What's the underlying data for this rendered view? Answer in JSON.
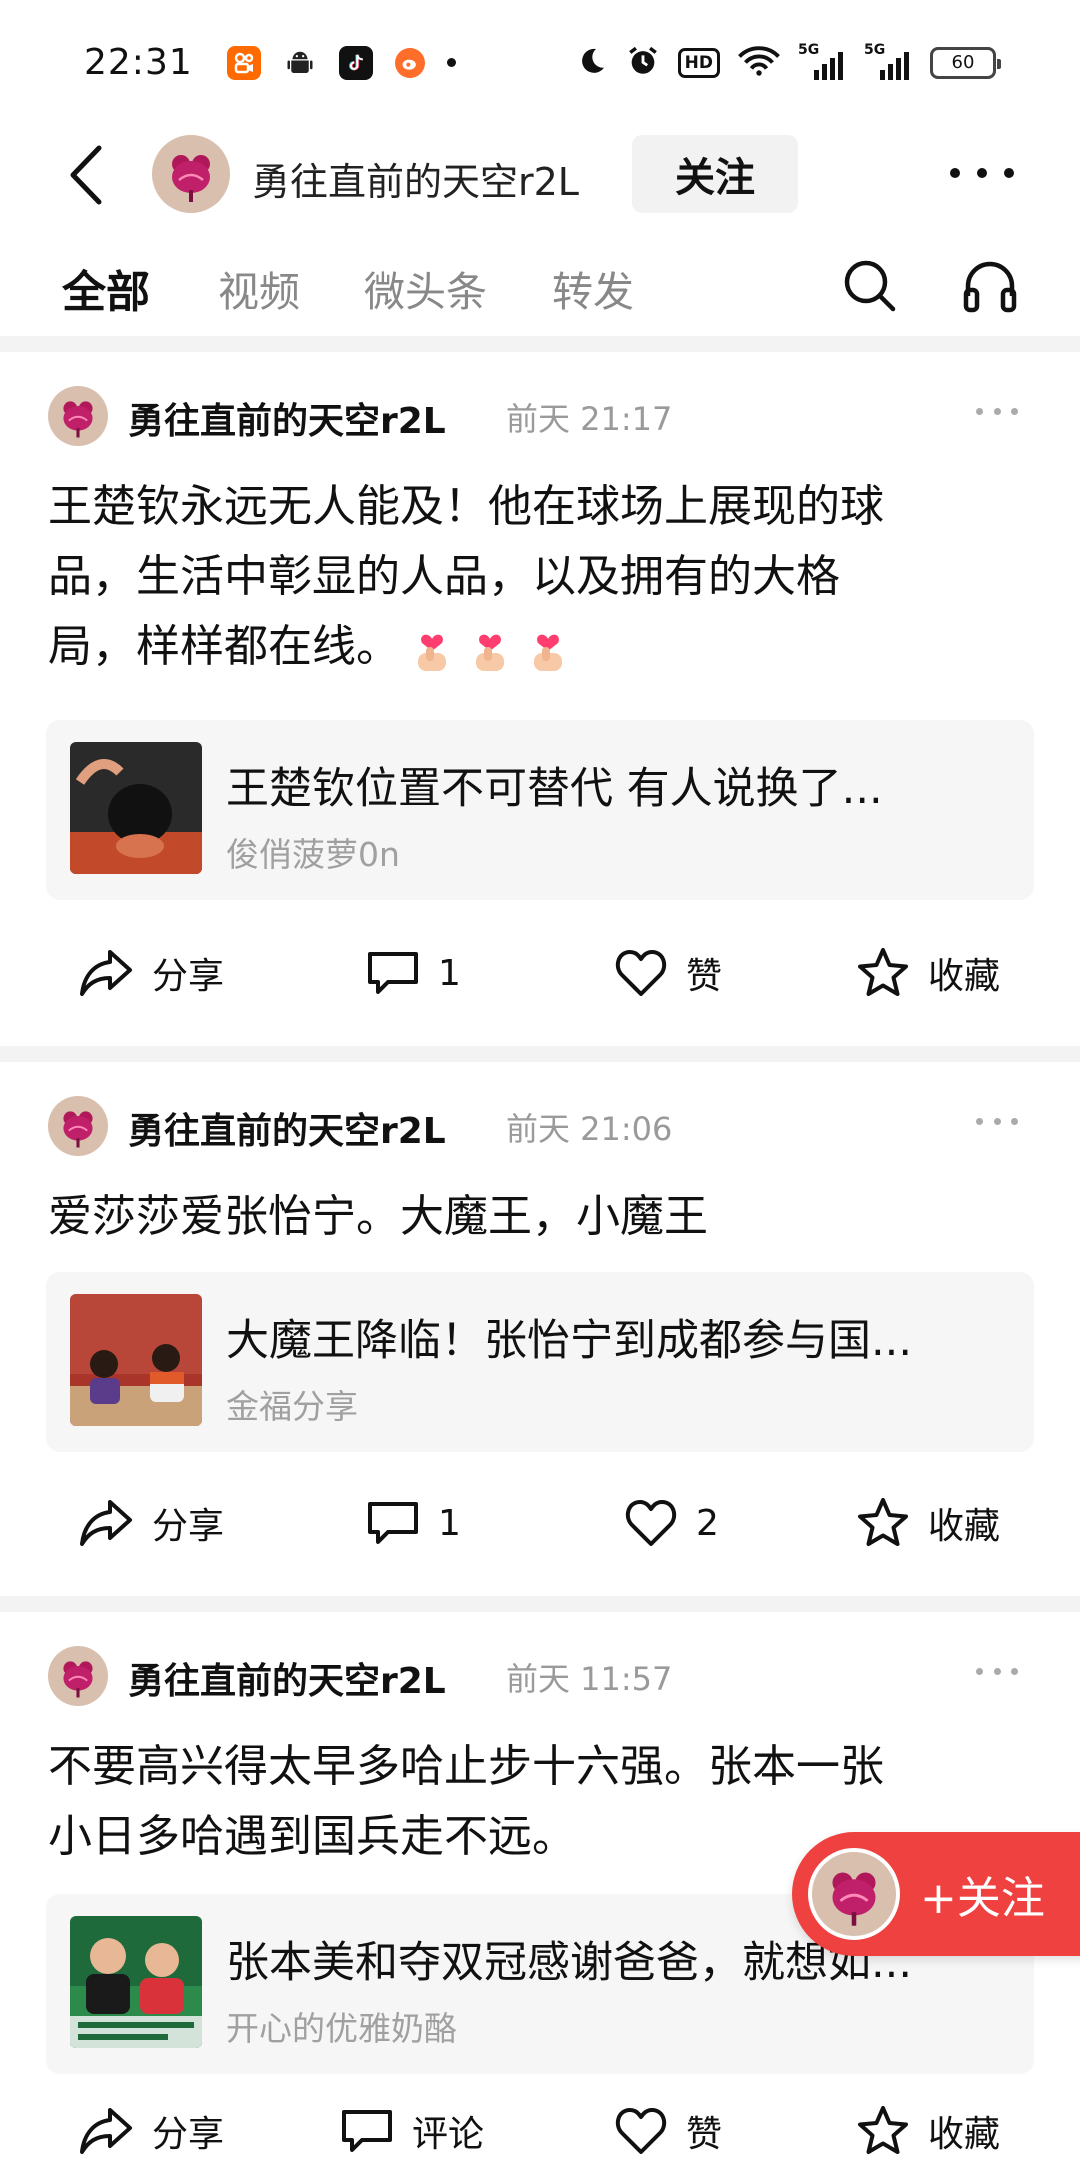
{
  "status_bar": {
    "time": "22:31",
    "hd_label": "HD",
    "signal_1": "5G",
    "signal_2": "5G",
    "battery": "60"
  },
  "header": {
    "account_name": "勇往直前的天空r2L",
    "follow_label": "关注"
  },
  "tabs": [
    {
      "label": "全部",
      "active": true
    },
    {
      "label": "视频",
      "active": false
    },
    {
      "label": "微头条",
      "active": false
    },
    {
      "label": "转发",
      "active": false
    }
  ],
  "posts": [
    {
      "author": "勇往直前的天空r2L",
      "time": "前天  21:17",
      "text_lines": [
        "王楚钦永远无人能及！他在球场上展现的球",
        "品，生活中彰显的人品，以及拥有的大格",
        "局，样样都在线。"
      ],
      "ref_title": "王楚钦位置不可替代  有人说换了...",
      "ref_source": "俊俏菠萝0n",
      "share": "分享",
      "comment": "1",
      "like": "赞",
      "favorite": "收藏"
    },
    {
      "author": "勇往直前的天空r2L",
      "time": "前天  21:06",
      "text_lines": [
        "爱莎莎爱张怡宁。大魔王，小魔王"
      ],
      "ref_title": "大魔王降临！张怡宁到成都参与国...",
      "ref_source": "金福分享",
      "share": "分享",
      "comment": "1",
      "like": "2",
      "favorite": "收藏"
    },
    {
      "author": "勇往直前的天空r2L",
      "time": "前天  11:57",
      "text_lines": [
        "不要高兴得太早多哈止步十六强。张本一张",
        "小日多哈遇到国兵走不远。"
      ],
      "ref_title": "张本美和夺双冠感谢爸爸，就想如...",
      "ref_source": "开心的优雅奶酪",
      "share": "分享",
      "comment": "评论",
      "like": "赞",
      "favorite": "收藏"
    }
  ],
  "float_follow": {
    "label": "+关注"
  }
}
